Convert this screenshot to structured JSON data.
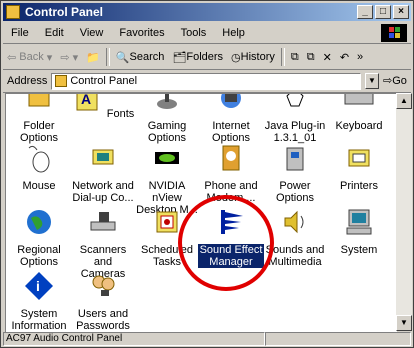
{
  "window": {
    "title": "Control Panel"
  },
  "menu": [
    "File",
    "Edit",
    "View",
    "Favorites",
    "Tools",
    "Help"
  ],
  "toolbar": {
    "back": "Back",
    "search": "Search",
    "folders": "Folders",
    "history": "History",
    "go": "Go"
  },
  "address": {
    "label": "Address",
    "value": "Control Panel"
  },
  "items": [
    {
      "label": "Folder Options",
      "icon": "folder-options-icon"
    },
    {
      "label": "Fonts",
      "icon": "fonts-icon"
    },
    {
      "label": "Gaming Options",
      "icon": "gaming-options-icon"
    },
    {
      "label": "Internet Options",
      "icon": "internet-options-icon"
    },
    {
      "label": "Java Plug-in 1.3.1_01",
      "icon": "java-plugin-icon"
    },
    {
      "label": "Keyboard",
      "icon": "keyboard-icon"
    },
    {
      "label": "Mouse",
      "icon": "mouse-icon"
    },
    {
      "label": "Network and Dial-up Co...",
      "icon": "network-icon"
    },
    {
      "label": "NVIDIA nView Desktop M...",
      "icon": "nvidia-icon"
    },
    {
      "label": "Phone and Modem ...",
      "icon": "phone-modem-icon"
    },
    {
      "label": "Power Options",
      "icon": "power-options-icon"
    },
    {
      "label": "Printers",
      "icon": "printers-icon"
    },
    {
      "label": "Regional Options",
      "icon": "regional-options-icon"
    },
    {
      "label": "Scanners and Cameras",
      "icon": "scanners-icon"
    },
    {
      "label": "Scheduled Tasks",
      "icon": "scheduled-tasks-icon"
    },
    {
      "label": "Sound Effect Manager",
      "icon": "sound-effect-manager-icon",
      "selected": true
    },
    {
      "label": "Sounds and Multimedia",
      "icon": "sounds-icon"
    },
    {
      "label": "System",
      "icon": "system-icon"
    },
    {
      "label": "System Information",
      "icon": "system-information-icon"
    },
    {
      "label": "Users and Passwords",
      "icon": "users-icon"
    }
  ],
  "status": {
    "text": "AC97 Audio Control Panel"
  },
  "colors": {
    "title_start": "#0a246a",
    "selection": "#0a246a",
    "highlight_circle": "#e00000"
  }
}
